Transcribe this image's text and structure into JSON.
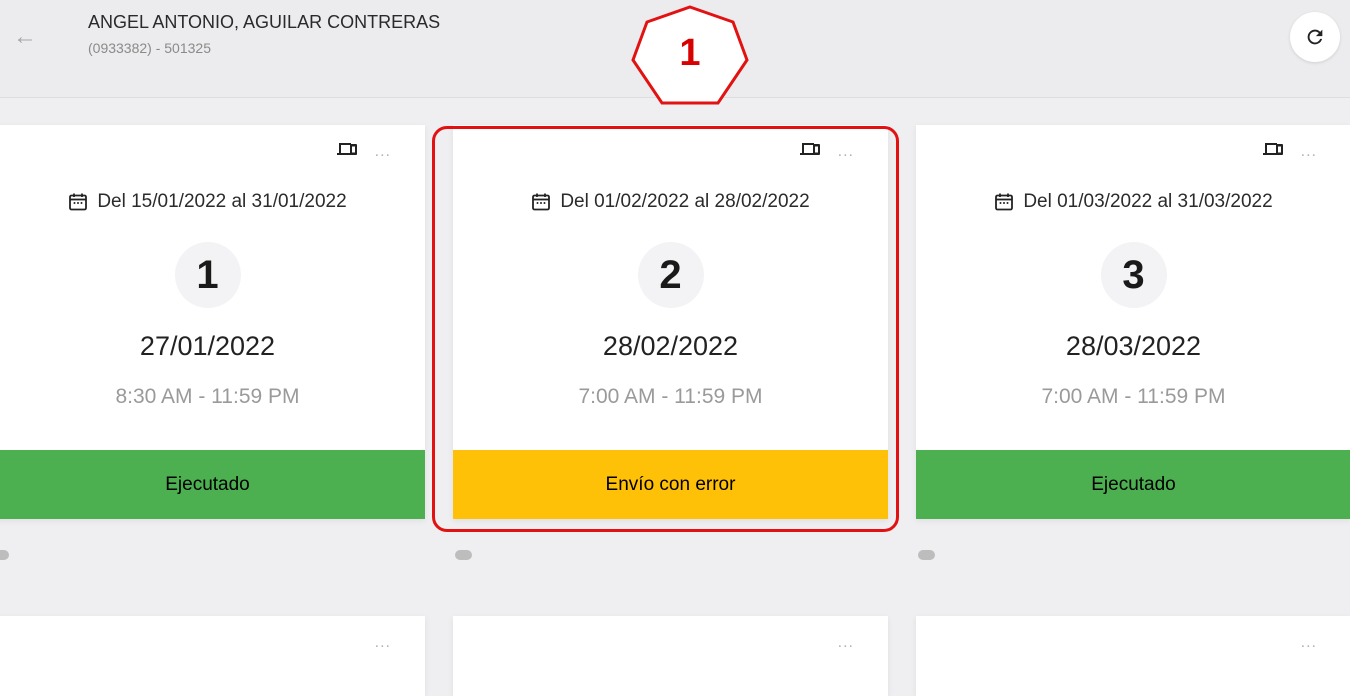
{
  "header": {
    "title": "ANGEL ANTONIO, AGUILAR CONTRERAS",
    "subtitle": "(0933382) - 501325",
    "back_icon": "arrow-left-icon",
    "refresh_icon": "refresh-icon"
  },
  "cards": [
    {
      "range": "Del 15/01/2022 al 31/01/2022",
      "number": "1",
      "date": "27/01/2022",
      "time": "8:30 AM - 11:59 PM",
      "status": "Ejecutado",
      "status_color": "#4caf50"
    },
    {
      "range": "Del 01/02/2022 al 28/02/2022",
      "number": "2",
      "date": "28/02/2022",
      "time": "7:00 AM - 11:59 PM",
      "status": "Envío con error",
      "status_color": "#ffc107"
    },
    {
      "range": "Del 01/03/2022 al 31/03/2022",
      "number": "3",
      "date": "28/03/2022",
      "time": "7:00 AM - 11:59 PM",
      "status": "Ejecutado",
      "status_color": "#4caf50"
    }
  ],
  "more_label": "...",
  "annotation": {
    "label": "1",
    "color": "#e31212"
  }
}
